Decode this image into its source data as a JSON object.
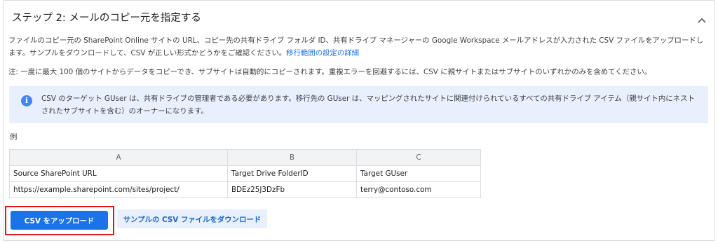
{
  "header": {
    "title": "ステップ 2: メールのコピー元を指定する",
    "collapse_icon": "chevron-up-icon"
  },
  "description": {
    "text": "ファイルのコピー元の SharePoint Online サイトの URL、コピー先の共有ドライブ フォルダ ID、共有ドライブ マネージャーの Google Workspace メールアドレスが入力された CSV ファイルをアップロードします。サンプルをダウンロードして、CSV が正しい形式かどうかをご確認ください。",
    "link": "移行範囲の設定の詳細"
  },
  "note": "注: 一度に最大 100 個のサイトからデータをコピーでき、サブサイトは自動的にコピーされます。重複エラーを回避するには、CSV に親サイトまたはサブサイトのいずれかのみを含めてください。",
  "info": {
    "icon": "info-icon",
    "text": "CSV のターゲット GUser は、共有ドライブの管理者である必要があります。移行先の GUser は、マッピングされたサイトに関連付けられているすべての共有ドライブ アイテム（親サイト内にネストされたサブサイトを含む）のオーナーになります。"
  },
  "example": {
    "label": "例",
    "columns": [
      "A",
      "B",
      "C"
    ],
    "rows": [
      [
        "Source SharePoint URL",
        "Target Drive FolderID",
        "Target GUser"
      ],
      [
        "https://example.sharepoint.com/sites/project/",
        "BDEz25J3DzFb",
        "terry@contoso.com"
      ]
    ]
  },
  "actions": {
    "upload_label": "CSV をアップロード",
    "download_label": "サンプルの CSV ファイルをダウンロード",
    "highlight_color": "#e0161a"
  },
  "colors": {
    "accent": "#1a73e8",
    "info_bg": "#e8f0fe"
  }
}
